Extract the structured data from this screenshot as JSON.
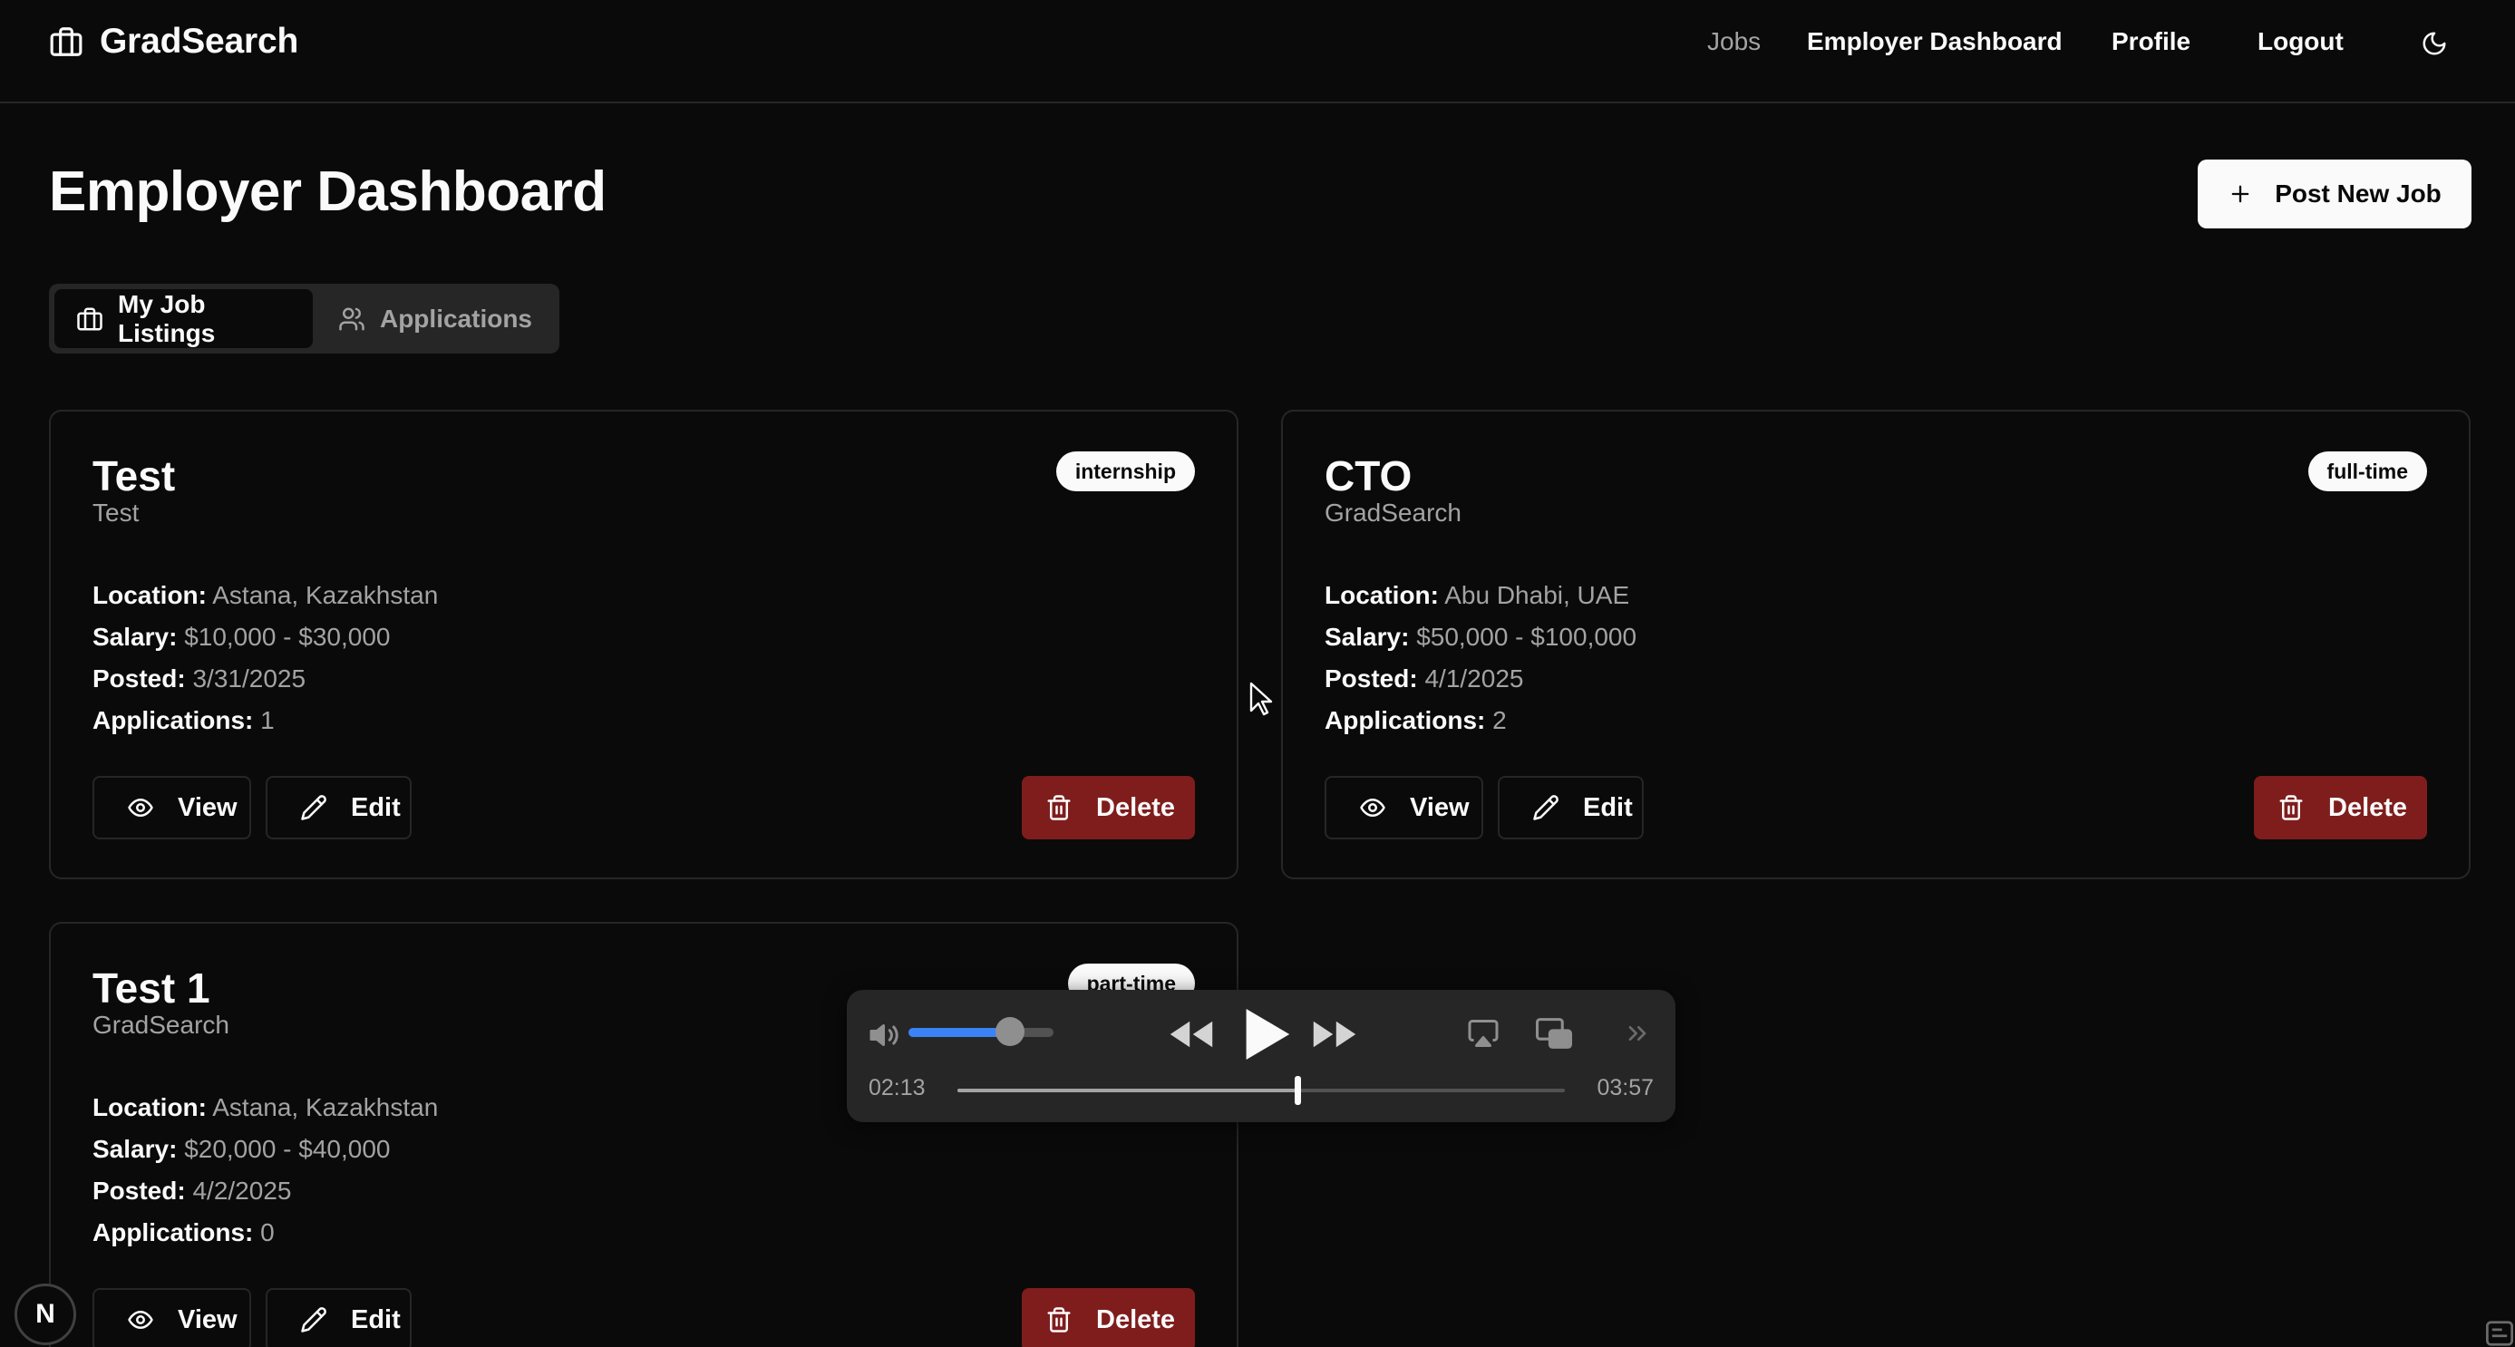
{
  "header": {
    "brand": "GradSearch",
    "nav": {
      "jobs": "Jobs",
      "dashboard": "Employer Dashboard",
      "profile": "Profile",
      "logout": "Logout"
    }
  },
  "page": {
    "title": "Employer Dashboard",
    "post_job_label": "Post New Job"
  },
  "tabs": {
    "listings": "My Job Listings",
    "applications": "Applications"
  },
  "labels": {
    "location": "Location:",
    "salary": "Salary:",
    "posted": "Posted:",
    "applications": "Applications:",
    "view": "View",
    "edit": "Edit",
    "delete": "Delete"
  },
  "jobs": [
    {
      "title": "Test",
      "company": "Test",
      "type": "internship",
      "location": "Astana, Kazakhstan",
      "salary": "$10,000 - $30,000",
      "posted": "3/31/2025",
      "applications": "1"
    },
    {
      "title": "CTO",
      "company": "GradSearch",
      "type": "full-time",
      "location": "Abu Dhabi, UAE",
      "salary": "$50,000 - $100,000",
      "posted": "4/1/2025",
      "applications": "2"
    },
    {
      "title": "Test 1",
      "company": "GradSearch",
      "type": "part-time",
      "location": "Astana, Kazakhstan",
      "salary": "$20,000 - $40,000",
      "posted": "4/2/2025",
      "applications": "0"
    }
  ],
  "player": {
    "current_time": "02:13",
    "total_time": "03:57",
    "progress": 0.56,
    "volume": 0.7
  },
  "dev_badge": "N",
  "colors": {
    "background": "#0a0a0a",
    "border": "#262626",
    "delete": "#7f1d1d",
    "volume_accent": "#3b82f6"
  }
}
